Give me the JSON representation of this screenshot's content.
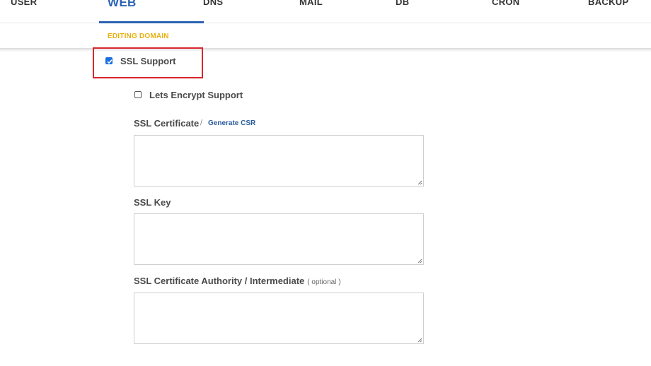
{
  "nav": {
    "items": [
      {
        "key": "user",
        "label": "USER"
      },
      {
        "key": "web",
        "label": "WEB",
        "active": true
      },
      {
        "key": "dns",
        "label": "DNS"
      },
      {
        "key": "mail",
        "label": "MAIL"
      },
      {
        "key": "db",
        "label": "DB"
      },
      {
        "key": "cron",
        "label": "CRON"
      },
      {
        "key": "backup",
        "label": "BACKUP"
      }
    ]
  },
  "subheader": {
    "label": "EDITING DOMAIN"
  },
  "form": {
    "ssl_support": {
      "label": "SSL Support",
      "checked": true
    },
    "letsencrypt": {
      "label": "Lets Encrypt Support",
      "checked": false
    },
    "ssl_certificate": {
      "label": "SSL Certificate",
      "separator": "/",
      "link": "Generate CSR",
      "value": ""
    },
    "ssl_key": {
      "label": "SSL Key",
      "value": ""
    },
    "ssl_ca": {
      "label": "SSL Certificate Authority / Intermediate",
      "note": "( optional )",
      "value": ""
    }
  },
  "colors": {
    "accent": "#2c63b3",
    "subheader": "#e8b10f",
    "highlight": "#d9262d",
    "checkbox": "#1a6fe0"
  }
}
